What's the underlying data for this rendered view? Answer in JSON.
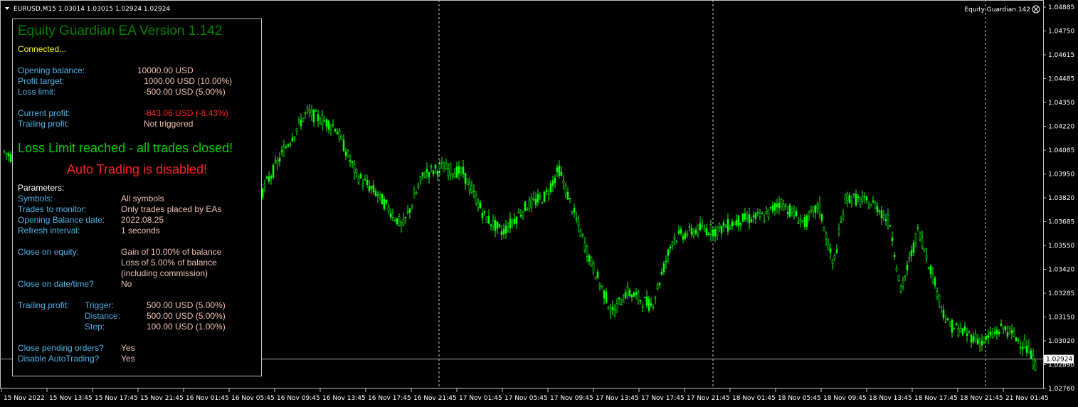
{
  "chart": {
    "header": "EURUSD,M15  1.03014 1.03015 1.02924 1.02924",
    "indicator_label": "Equity Guardian.142",
    "price_labels": [
      "1.04885",
      "1.04750",
      "1.04615",
      "1.04485",
      "1.04350",
      "1.04220",
      "1.04085",
      "1.03950",
      "1.03820",
      "1.03685",
      "1.03550",
      "1.03420",
      "1.03285",
      "1.03150",
      "1.03020",
      "1.02890",
      "1.02760"
    ],
    "current_price": "1.02924",
    "time_labels": [
      "15 Nov 2022",
      "15 Nov 13:45",
      "15 Nov 17:45",
      "15 Nov 21:45",
      "16 Nov 01:45",
      "16 Nov 05:45",
      "16 Nov 09:45",
      "16 Nov 13:45",
      "16 Nov 17:45",
      "16 Nov 21:45",
      "17 Nov 01:45",
      "17 Nov 05:45",
      "17 Nov 09:45",
      "17 Nov 13:45",
      "17 Nov 17:45",
      "17 Nov 21:45",
      "18 Nov 01:45",
      "18 Nov 05:45",
      "18 Nov 09:45",
      "18 Nov 13:45",
      "18 Nov 17:45",
      "18 Nov 21:45",
      "21 Nov 01:45"
    ],
    "candle_color": "#00ff00",
    "grid_color": "#c8c8c8"
  },
  "panel": {
    "title": "Equity Guardian EA Version 1.142",
    "status": "Connected...",
    "opening_balance_label": "Opening balance:",
    "opening_balance_value": "10000.00 USD",
    "profit_target_label": "Profit target:",
    "profit_target_value": "1000.00 USD (10.00%)",
    "loss_limit_label": "Loss limit:",
    "loss_limit_value": "-500.00 USD (5.00%)",
    "current_profit_label": "Current profit:",
    "current_profit_value": "-843.06 USD (-8.43%)",
    "trailing_profit_label": "Trailing profit:",
    "trailing_profit_value": "Not triggered",
    "loss_limit_msg": "Loss Limit reached - all trades closed!",
    "autotrading_msg": "Auto Trading is disabled!",
    "parameters_heading": "Parameters:",
    "symbols_label": "Symbols:",
    "symbols_value": "All symbols",
    "trades_label": "Trades to monitor:",
    "trades_value": "Only trades placed by EAs",
    "opening_date_label": "Opening Balance date:",
    "opening_date_value": "2022.08.25",
    "refresh_label": "Refresh interval:",
    "refresh_value": "1 seconds",
    "close_equity_label": "Close on equity:",
    "close_equity_line1": "Gain of 10.00% of balance",
    "close_equity_line2": "Loss of 5.00% of balance",
    "close_equity_line3": "(including commission)",
    "close_datetime_label": "Close on date/time?",
    "close_datetime_value": "No",
    "trailing_label": "Trailing profit:",
    "trigger_label": "Trigger:",
    "trigger_value": "500.00 USD (5.00%)",
    "distance_label": "Distance:",
    "distance_value": "500.00 USD (5.00%)",
    "step_label": "Step:",
    "step_value": "100.00 USD (1.00%)",
    "close_pending_label": "Close pending orders?",
    "close_pending_value": "Yes",
    "disable_at_label": "Disable AutoTrading?",
    "disable_at_value": "Yes",
    "title_color": "#008000",
    "status_color": "#ffff00",
    "loss_color": "#ff2020",
    "msg_green_color": "#00d000"
  }
}
